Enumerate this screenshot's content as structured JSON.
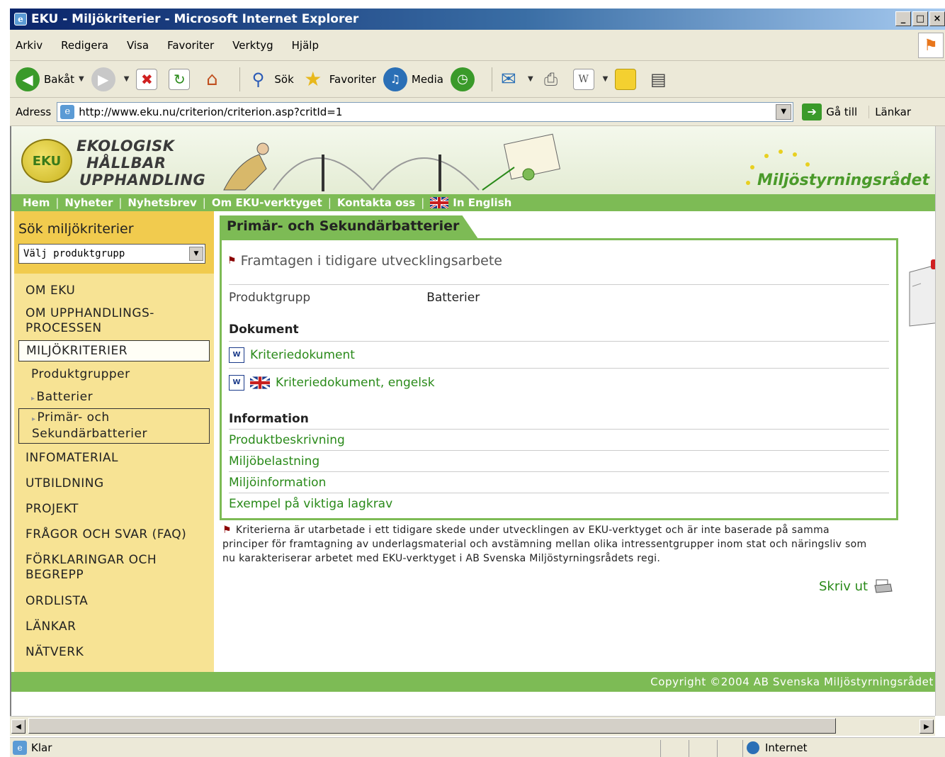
{
  "window": {
    "title": "EKU - Miljökriterier - Microsoft Internet Explorer",
    "controls": [
      "_",
      "□",
      "×"
    ]
  },
  "menubar": [
    "Arkiv",
    "Redigera",
    "Visa",
    "Favoriter",
    "Verktyg",
    "Hjälp"
  ],
  "toolbar": {
    "back": "Bakåt",
    "search": "Sök",
    "favorites": "Favoriter",
    "media": "Media"
  },
  "addressbar": {
    "label": "Adress",
    "url": "http://www.eku.nu/criterion/criterion.asp?critId=1",
    "go": "Gå till",
    "links": "Länkar"
  },
  "site": {
    "logo_initials": "EKU",
    "logo_lines": [
      "EKOLOGISK",
      "HÅLLBAR",
      "UPPHANDLING"
    ],
    "partner": "Miljöstyrningsrådet",
    "nav": [
      "Hem",
      "Nyheter",
      "Nyhetsbrev",
      "Om EKU-verktyget",
      "Kontakta oss",
      "In English"
    ],
    "search_label": "Sök miljökriterier",
    "select_value": "Välj produktgrupp",
    "menu": {
      "om_eku": "OM EKU",
      "om_upphandling": "OM UPPHANDLINGS-\nPROCESSEN",
      "miljokriterier": "MILJÖKRITERIER",
      "produktgrupper": "Produktgrupper",
      "batterier": "Batterier",
      "primar": "Primär- och Sekundärbatterier",
      "infomaterial": "INFOMATERIAL",
      "utbildning": "UTBILDNING",
      "projekt": "PROJEKT",
      "faq": "FRÅGOR OCH SVAR (FAQ)",
      "forklaringar": "FÖRKLARINGAR OCH BEGREPP",
      "ordlista": "ORDLISTA",
      "lankar": "LÄNKAR",
      "natverk": "NÄTVERK"
    },
    "main": {
      "title": "Primär- och Sekundärbatterier",
      "dev_note": "Framtagen i tidigare utvecklingsarbete",
      "prod_label": "Produktgrupp",
      "prod_value": "Batterier",
      "doc_heading": "Dokument",
      "doc1": "Kriteriedokument",
      "doc2": "Kriteriedokument, engelsk",
      "info_heading": "Information",
      "info1": "Produktbeskrivning",
      "info2": "Miljöbelastning",
      "info3": "Miljöinformation",
      "info4": "Exempel på viktiga lagkrav",
      "footnote": "Kriterierna är utarbetade i ett tidigare skede under utvecklingen av EKU-verktyget och är inte baserade på samma principer för framtagning av underlagsmaterial och avstämning mellan olika intressentgrupper inom stat och näringsliv som nu karakteriserar arbetet med EKU-verktyget i AB Svenska Miljöstyrningsrådets regi.",
      "print": "Skriv ut"
    },
    "footer": "Copyright ©2004 AB Svenska Miljöstyrningsrådet"
  },
  "status": {
    "text": "Klar",
    "zone": "Internet"
  },
  "colors": {
    "green": "#7dbb55",
    "link": "#2a8a1a",
    "sidebar": "#f7e394",
    "sidebar_top": "#f1cb4e"
  }
}
